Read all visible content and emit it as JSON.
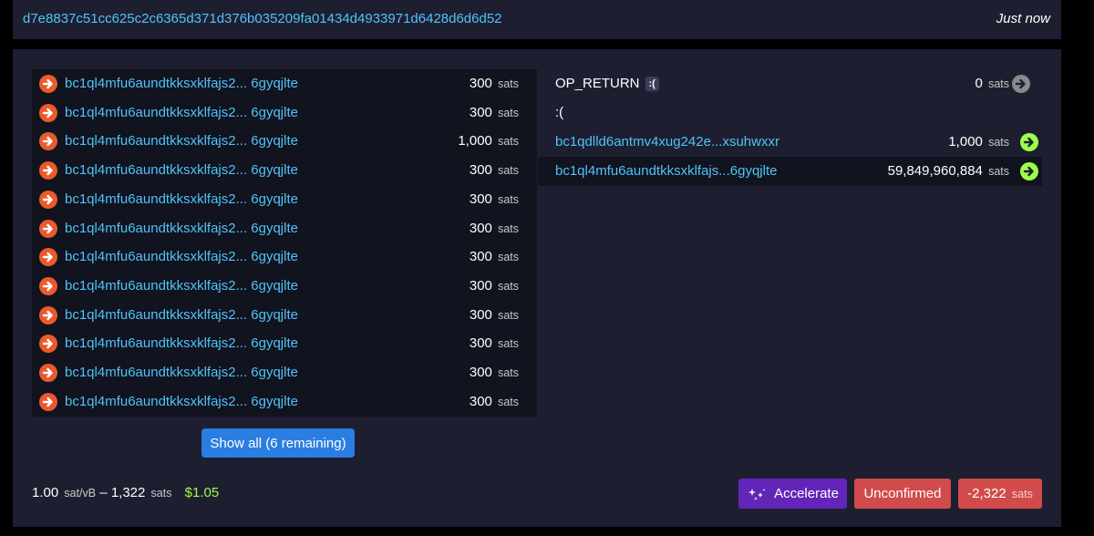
{
  "header": {
    "txid": "d7e8837c51cc625c2c6365d371d376b035209fa01434d4933971d6428d6d6d52",
    "time": "Just now"
  },
  "inputs": [
    {
      "address": "bc1ql4mfu6aundtkksxklfajs2... 6gyqjlte",
      "amount": "300",
      "unit": "sats"
    },
    {
      "address": "bc1ql4mfu6aundtkksxklfajs2... 6gyqjlte",
      "amount": "300",
      "unit": "sats"
    },
    {
      "address": "bc1ql4mfu6aundtkksxklfajs2... 6gyqjlte",
      "amount": "1,000",
      "unit": "sats"
    },
    {
      "address": "bc1ql4mfu6aundtkksxklfajs2... 6gyqjlte",
      "amount": "300",
      "unit": "sats"
    },
    {
      "address": "bc1ql4mfu6aundtkksxklfajs2... 6gyqjlte",
      "amount": "300",
      "unit": "sats"
    },
    {
      "address": "bc1ql4mfu6aundtkksxklfajs2... 6gyqjlte",
      "amount": "300",
      "unit": "sats"
    },
    {
      "address": "bc1ql4mfu6aundtkksxklfajs2... 6gyqjlte",
      "amount": "300",
      "unit": "sats"
    },
    {
      "address": "bc1ql4mfu6aundtkksxklfajs2... 6gyqjlte",
      "amount": "300",
      "unit": "sats"
    },
    {
      "address": "bc1ql4mfu6aundtkksxklfajs2... 6gyqjlte",
      "amount": "300",
      "unit": "sats"
    },
    {
      "address": "bc1ql4mfu6aundtkksxklfajs2... 6gyqjlte",
      "amount": "300",
      "unit": "sats"
    },
    {
      "address": "bc1ql4mfu6aundtkksxklfajs2... 6gyqjlte",
      "amount": "300",
      "unit": "sats"
    },
    {
      "address": "bc1ql4mfu6aundtkksxklfajs2... 6gyqjlte",
      "amount": "300",
      "unit": "sats"
    }
  ],
  "show_all_label": "Show all (6 remaining)",
  "outputs": {
    "op_return": {
      "label": "OP_RETURN",
      "badge": ":(",
      "amount": "0",
      "unit": "sats",
      "data": ":("
    },
    "rows": [
      {
        "address": "bc1qdlld6antmv4xug242e...xsuhwxxr",
        "amount": "1,000",
        "unit": "sats"
      },
      {
        "address": "bc1ql4mfu6aundtkksxklfajs...6gyqjlte",
        "amount": "59,849,960,884",
        "unit": "sats"
      }
    ]
  },
  "footer": {
    "fee_rate": "1.00",
    "fee_rate_unit": "sat/vB",
    "separator": "–",
    "fee": "1,322",
    "fee_unit": "sats",
    "usd": "$1.05",
    "accelerate_label": "Accelerate",
    "status_label": "Unconfirmed",
    "delta": "-2,322",
    "delta_unit": "sats"
  },
  "colors": {
    "input_arrow": "#ea5a2c",
    "output_arrow_spent": "#9cff4b",
    "output_arrow_opreturn": "#8a8a8a",
    "link": "#4fc3f7"
  },
  "icons": {
    "input_arrow": "arrow-right-circle-icon",
    "output_arrow": "arrow-right-circle-icon",
    "accelerate": "sparkles-icon"
  }
}
